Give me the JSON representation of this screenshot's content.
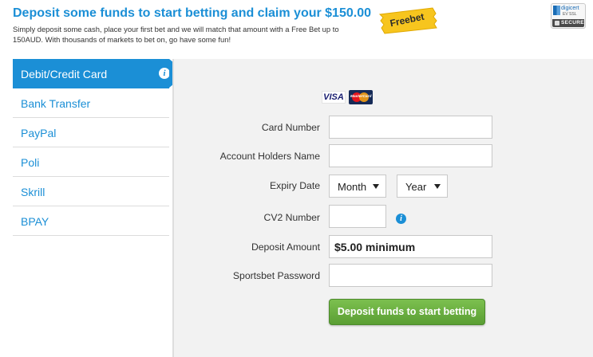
{
  "banner": {
    "headline": "Deposit some funds to start betting and claim your $150.00",
    "subtext": "Simply deposit some cash, place your first bet and we will match that amount with a Free Bet up to 150AUD. With thousands of markets to bet on, go have some fun!",
    "freebet_badge": "Freebet",
    "ssl_badge": {
      "brand": "digicert",
      "sub": "EV SSL",
      "secure": "SECURE"
    }
  },
  "sidebar": {
    "items": [
      {
        "label": "Debit/Credit Card",
        "active": true
      },
      {
        "label": "Bank Transfer",
        "active": false
      },
      {
        "label": "PayPal",
        "active": false
      },
      {
        "label": "Poli",
        "active": false
      },
      {
        "label": "Skrill",
        "active": false
      },
      {
        "label": "BPAY",
        "active": false
      }
    ]
  },
  "form": {
    "card_logos": [
      "VISA",
      "MasterCard"
    ],
    "card_number_label": "Card Number",
    "card_number_value": "",
    "account_holder_label": "Account Holders Name",
    "account_holder_value": "",
    "expiry_label": "Expiry Date",
    "expiry_month": "Month",
    "expiry_year": "Year",
    "cv2_label": "CV2 Number",
    "cv2_value": "",
    "deposit_label": "Deposit Amount",
    "deposit_value": "$5.00 minimum",
    "password_label": "Sportsbet Password",
    "password_value": "",
    "submit_label": "Deposit funds to start betting"
  },
  "colors": {
    "accent": "#1b8fd6",
    "panel_bg": "#f2f2f2",
    "submit_green": "#6aae3f",
    "badge_yellow": "#f7c51e"
  }
}
